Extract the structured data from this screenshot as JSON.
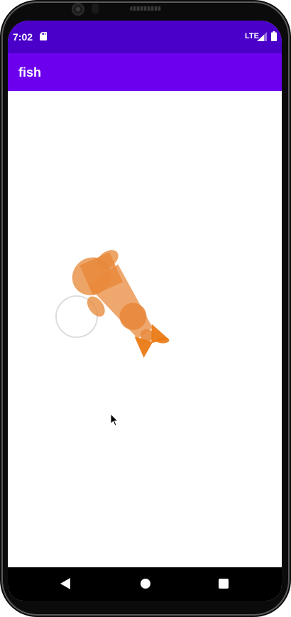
{
  "status_bar": {
    "time": "7:02",
    "network": "LTE",
    "sd_icon": "sd-card-icon",
    "signal_icon": "cell-signal-icon",
    "battery_icon": "battery-icon"
  },
  "app_bar": {
    "title": "fish"
  },
  "nav_bar": {
    "back_icon": "back-triangle-icon",
    "home_icon": "home-circle-icon",
    "recents_icon": "recents-square-icon"
  },
  "colors": {
    "status_bar": "#4a00c8",
    "app_bar": "#6c00ee",
    "fish_body": "#e88a3c",
    "fish_tail": "#ea7a14",
    "touch_ring": "#dddddd"
  }
}
